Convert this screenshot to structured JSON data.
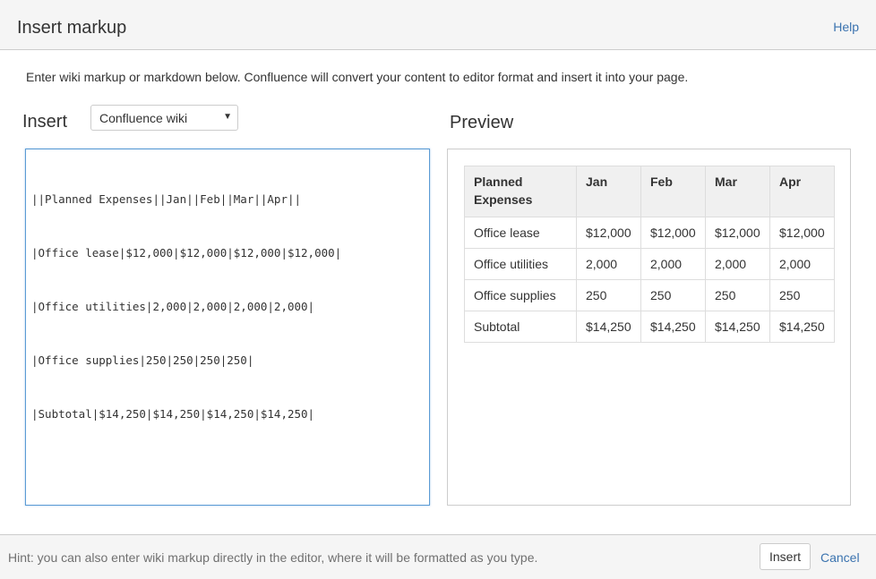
{
  "header": {
    "title": "Insert markup",
    "help_label": "Help"
  },
  "intro_text": "Enter wiki markup or markdown below. Confluence will convert your content to editor format and insert it into your page.",
  "insert_label": "Insert",
  "format_select": {
    "selected": "Confluence wiki"
  },
  "preview_label": "Preview",
  "markup_lines": [
    "||Planned Expenses||Jan||Feb||Mar||Apr||",
    "|Office lease|$12,000|$12,000|$12,000|$12,000|",
    "|Office utilities|2,000|2,000|2,000|2,000|",
    "|Office supplies|250|250|250|250|",
    "|Subtotal|$14,250|$14,250|$14,250|$14,250|"
  ],
  "preview_table": {
    "headers": [
      "Planned Expenses",
      "Jan",
      "Feb",
      "Mar",
      "Apr"
    ],
    "rows": [
      [
        "Office lease",
        "$12,000",
        "$12,000",
        "$12,000",
        "$12,000"
      ],
      [
        "Office utilities",
        "2,000",
        "2,000",
        "2,000",
        "2,000"
      ],
      [
        "Office supplies",
        "250",
        "250",
        "250",
        "250"
      ],
      [
        "Subtotal",
        "$14,250",
        "$14,250",
        "$14,250",
        "$14,250"
      ]
    ]
  },
  "footer": {
    "hint": "Hint: you can also enter wiki markup directly in the editor, where it will be formatted as you type.",
    "insert_button": "Insert",
    "cancel_label": "Cancel"
  },
  "colors": {
    "link": "#3b73af",
    "focus_border": "#5b9bd5",
    "header_bg": "#f5f5f5"
  }
}
